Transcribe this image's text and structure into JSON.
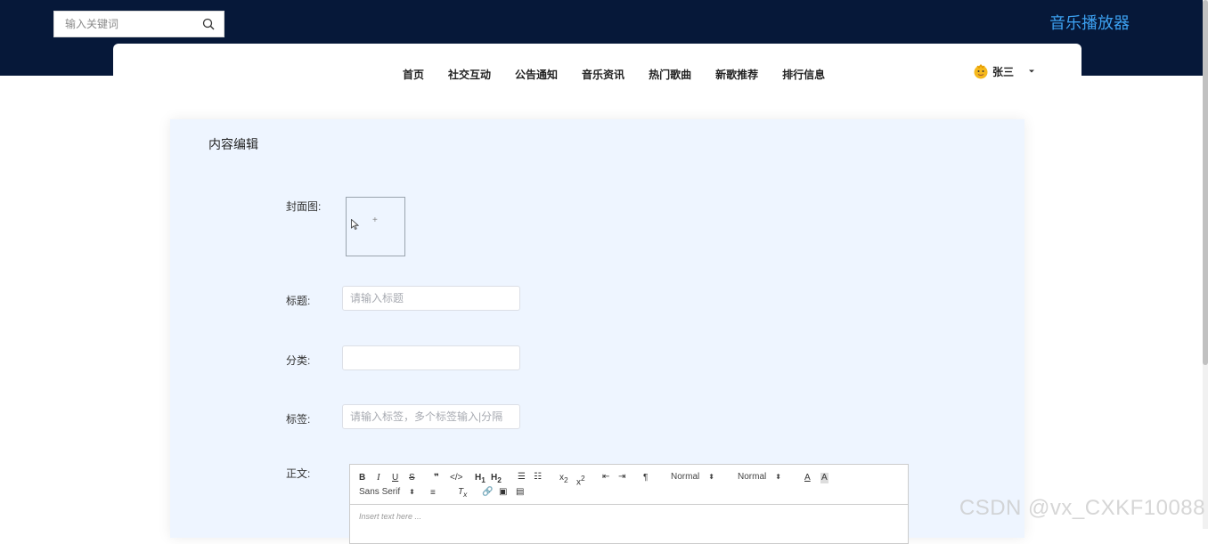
{
  "header": {
    "search_placeholder": "输入关键词",
    "brand": "音乐播放器",
    "nav": [
      "首页",
      "社交互动",
      "公告通知",
      "音乐资讯",
      "热门歌曲",
      "新歌推荐",
      "排行信息"
    ],
    "user_name": "张三"
  },
  "form": {
    "title": "内容编辑",
    "cover_label": "封面图:",
    "title_label": "标题:",
    "title_placeholder": "请输入标题",
    "category_label": "分类:",
    "category_value": "",
    "tags_label": "标签:",
    "tags_placeholder": "请输入标签，多个标签输入|分隔",
    "body_label": "正文:"
  },
  "editor": {
    "header1": "Normal",
    "header2": "Normal",
    "font": "Sans Serif",
    "placeholder": "Insert text here ..."
  },
  "watermark": "CSDN @vx_CXKF10088",
  "colors": {
    "header_bg": "#061839",
    "brand": "#3ca0f0",
    "panel_bg": "#eef5ff"
  }
}
